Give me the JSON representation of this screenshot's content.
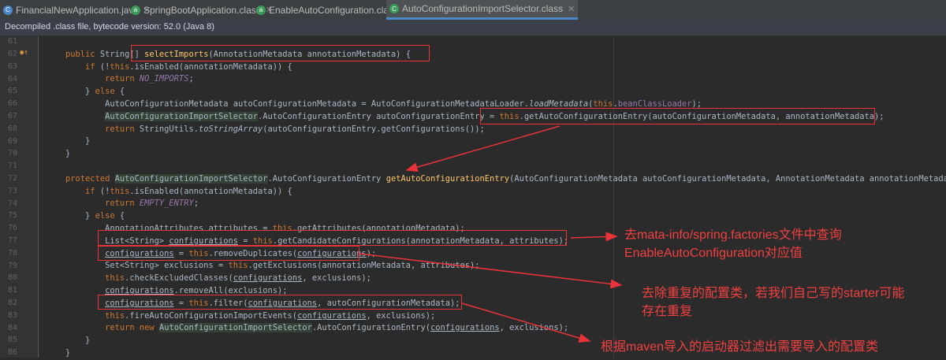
{
  "tabs": [
    {
      "label": "FinancialNewApplication.java",
      "icon": "java-class-icon"
    },
    {
      "label": "SpringBootApplication.class",
      "icon": "class-file-icon"
    },
    {
      "label": "EnableAutoConfiguration.class",
      "icon": "class-file-icon"
    },
    {
      "label": "AutoConfigurationImportSelector.class",
      "icon": "class-file-icon",
      "active": true
    }
  ],
  "banner": "Decompiled .class file, bytecode version: 52.0 (Java 8)",
  "line_numbers": [
    "61",
    "62",
    "63",
    "64",
    "65",
    "66",
    "67",
    "68",
    "69",
    "70",
    "71",
    "72",
    "73",
    "74",
    "75",
    "76",
    "77",
    "78",
    "79",
    "80",
    "81",
    "82",
    "83",
    "84",
    "85",
    "86"
  ],
  "code_lines": [
    "",
    "    public String[] selectImports(AnnotationMetadata annotationMetadata) {",
    "        if (!this.isEnabled(annotationMetadata)) {",
    "            return NO_IMPORTS;",
    "        } else {",
    "            AutoConfigurationMetadata autoConfigurationMetadata = AutoConfigurationMetadataLoader.loadMetadata(this.beanClassLoader);",
    "            AutoConfigurationImportSelector.AutoConfigurationEntry autoConfigurationEntry = this.getAutoConfigurationEntry(autoConfigurationMetadata, annotationMetadata);",
    "            return StringUtils.toStringArray(autoConfigurationEntry.getConfigurations());",
    "        }",
    "    }",
    "",
    "    protected AutoConfigurationImportSelector.AutoConfigurationEntry getAutoConfigurationEntry(AutoConfigurationMetadata autoConfigurationMetadata, AnnotationMetadata annotationMetadata) {",
    "        if (!this.isEnabled(annotationMetadata)) {",
    "            return EMPTY_ENTRY;",
    "        } else {",
    "            AnnotationAttributes attributes = this.getAttributes(annotationMetadata);",
    "            List<String> configurations = this.getCandidateConfigurations(annotationMetadata, attributes);",
    "            configurations = this.removeDuplicates(configurations);",
    "            Set<String> exclusions = this.getExclusions(annotationMetadata, attributes);",
    "            this.checkExcludedClasses(configurations, exclusions);",
    "            configurations.removeAll(exclusions);",
    "            configurations = this.filter(configurations, autoConfigurationMetadata);",
    "            this.fireAutoConfigurationImportEvents(configurations, exclusions);",
    "            return new AutoConfigurationImportSelector.AutoConfigurationEntry(configurations, exclusions);",
    "        }",
    "    }"
  ],
  "annotations": {
    "spring_factories_line1": "去mata-info/spring.factories文件中查询",
    "spring_factories_line2": "EnableAutoConfiguration对应值",
    "dedup_line1": "去除重复的配置类，若我们自己写的starter可能",
    "dedup_line2": "存在重复",
    "filter": "根据maven导入的启动器过滤出需要导入的配置类"
  },
  "colors": {
    "background": "#2b2b2b",
    "keyword": "#cc7832",
    "method": "#ffc66d",
    "field": "#9876aa",
    "annotation_red": "#e8333a"
  }
}
